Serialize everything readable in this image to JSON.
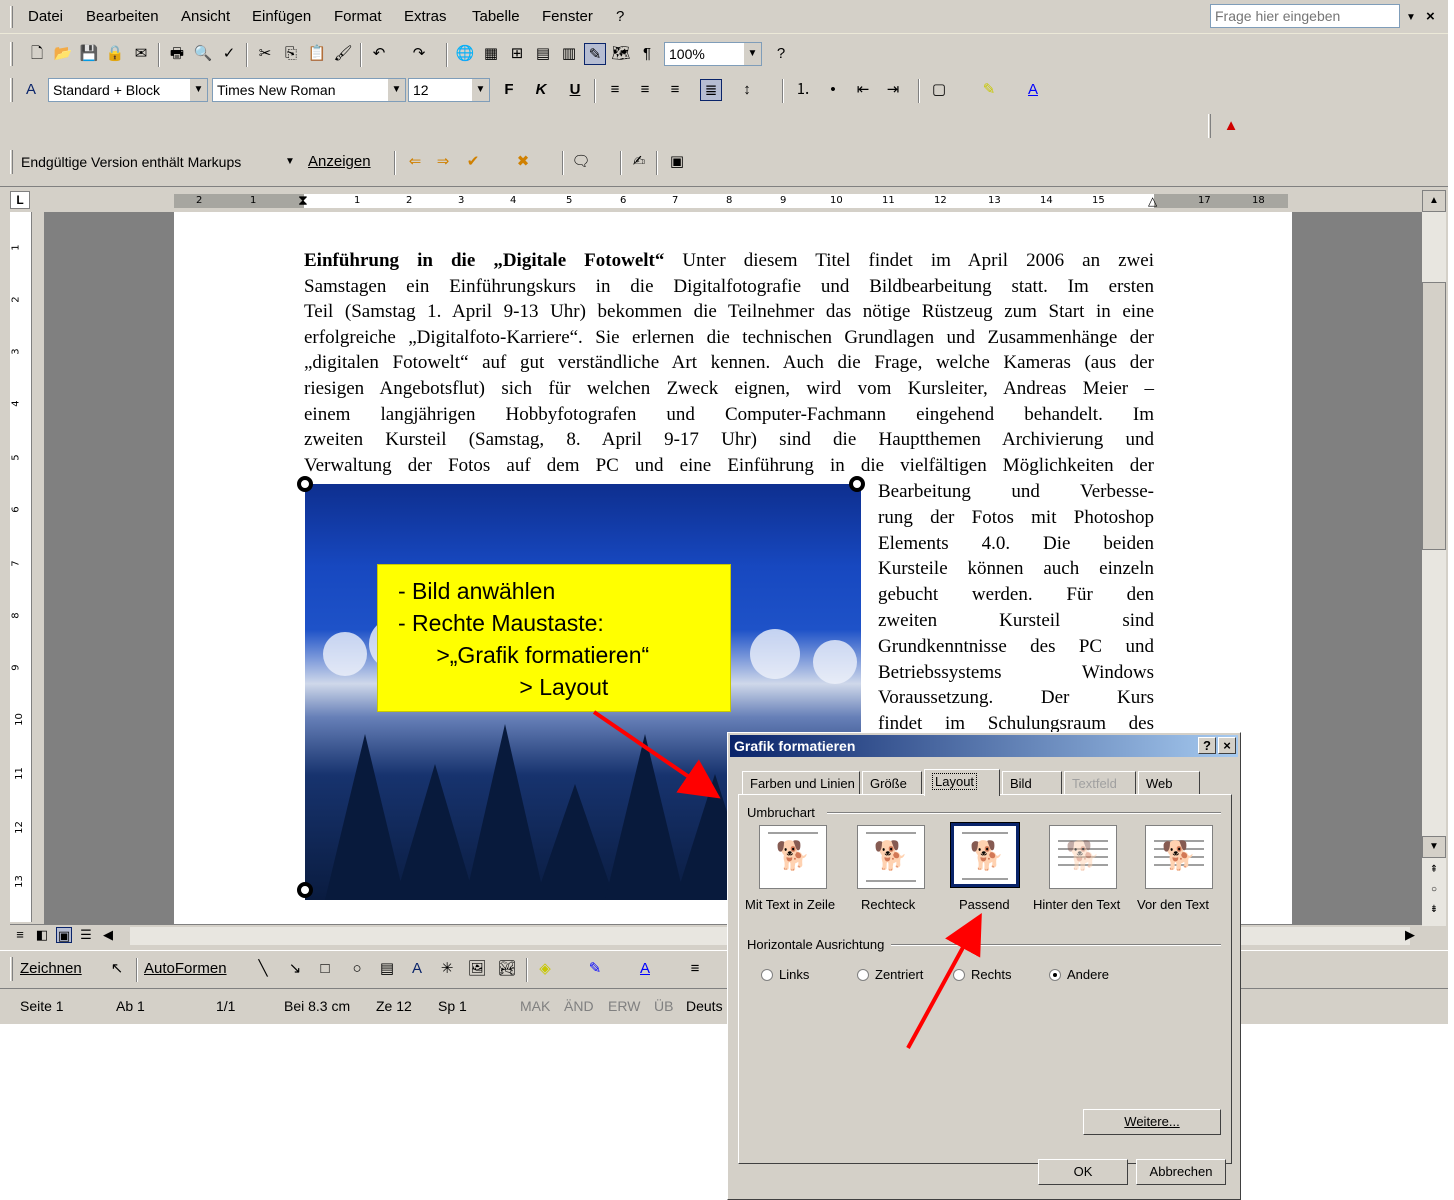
{
  "menu": {
    "items": [
      "Datei",
      "Bearbeiten",
      "Ansicht",
      "Einfügen",
      "Format",
      "Extras",
      "Tabelle",
      "Fenster",
      "?"
    ],
    "help_placeholder": "Frage hier eingeben",
    "close_glyph": "×"
  },
  "toolbar_standard": {
    "zoom": "100%"
  },
  "toolbar_format": {
    "style": "Standard + Block",
    "font": "Times New Roman",
    "size": "12",
    "bold": "F",
    "italic": "K",
    "underline": "U"
  },
  "toolbar_review": {
    "display_mode": "Endgültige Version enthält Markups",
    "show_label": "Anzeigen"
  },
  "ruler": {
    "corner": "L",
    "h_labels": [
      "2",
      "1",
      "1",
      "2",
      "3",
      "4",
      "5",
      "6",
      "7",
      "8",
      "9",
      "10",
      "11",
      "12",
      "13",
      "14",
      "15",
      "17",
      "18"
    ],
    "v_labels": [
      "1",
      "2",
      "3",
      "4",
      "5",
      "6",
      "7",
      "8",
      "9",
      "10",
      "11",
      "12",
      "13"
    ]
  },
  "document": {
    "bold_start": "Einführung in die „Digitale Fotowelt“",
    "lines": [
      " Unter diesem Titel findet im April 2006 an zwei",
      "Samstagen ein Einführungskurs in die Digitalfotografie und Bildbearbeitung statt. Im ersten",
      "Teil (Samstag 1. April 9-13 Uhr) bekommen die Teilnehmer das nötige Rüstzeug zum Start in eine",
      "erfolgreiche „Digitalfoto-Karriere“. Sie erlernen die technischen Grundlagen und Zusammenhänge der",
      "„digitalen Fotowelt“ auf gut verständliche Art kennen. Auch die Frage, welche Kameras (aus der",
      "riesigen Angebotsflut) sich für welchen Zweck eignen, wird vom Kursleiter, Andreas Meier –",
      "einem langjährigen Hobbyfotografen und Computer-Fachmann eingehend behandelt. Im",
      "zweiten Kursteil (Samstag, 8. April 9-17 Uhr) sind die Hauptthemen Archivierung und",
      "Verwaltung der Fotos auf dem PC und eine Einführung in die vielfältigen Möglichkeiten der"
    ],
    "side_lines": [
      "Bearbeitung und Verbesse-",
      "rung der Fotos mit Photoshop",
      "Elements 4.0. Die beiden",
      "Kursteile können auch einzeln",
      "gebucht werden. Für den",
      "zweiten Kursteil sind",
      "Grundkenntnisse des PC und",
      "Betriebssystems Windows",
      "Voraussetzung. Der Kurs",
      "findet im Schulungsraum des"
    ]
  },
  "callout": {
    "lines": [
      "- Bild anwählen",
      "- Rechte Maustaste:",
      "      >„Grafik formatieren“",
      "                   > Layout"
    ]
  },
  "drawing_toolbar": {
    "draw_label": "Zeichnen",
    "autoshapes_label": "AutoFormen"
  },
  "statusbar": {
    "page": "Seite 1",
    "section": "Ab 1",
    "pages": "1/1",
    "position": "Bei 8.3 cm",
    "line": "Ze 12",
    "column": "Sp 1",
    "mak": "MAK",
    "aend": "ÄND",
    "erw": "ERW",
    "ueb": "ÜB",
    "language": "Deuts"
  },
  "dialog": {
    "title": "Grafik formatieren",
    "help_glyph": "?",
    "close_glyph": "×",
    "tabs": [
      "Farben und Linien",
      "Größe",
      "Layout",
      "Bild",
      "Textfeld",
      "Web"
    ],
    "active_tab": "Layout",
    "wrap_group": "Umbruchart",
    "wrap_options": [
      "Mit Text in Zeile",
      "Rechteck",
      "Passend",
      "Hinter den Text",
      "Vor den Text"
    ],
    "selected_wrap": "Passend",
    "align_group": "Horizontale Ausrichtung",
    "align_options": [
      "Links",
      "Zentriert",
      "Rechts",
      "Andere"
    ],
    "selected_align": "Andere",
    "more_button": "Weitere...",
    "ok_button": "OK",
    "cancel_button": "Abbrechen"
  },
  "colors": {
    "arrow": "#ff0000",
    "callout": "#ffff00",
    "titlebar_start": "#0a246a",
    "titlebar_end": "#a6caf0"
  }
}
